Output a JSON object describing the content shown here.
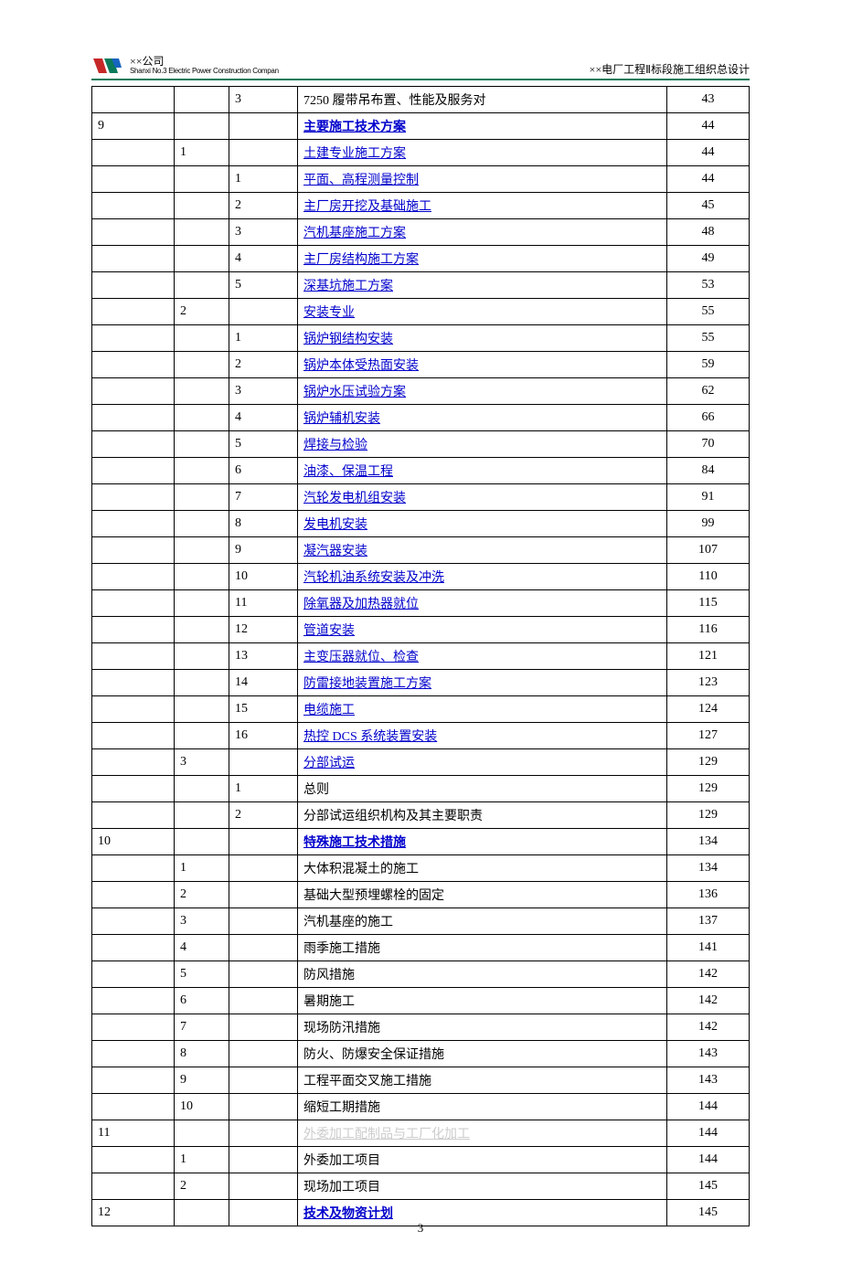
{
  "header": {
    "company_cn": "××公司",
    "company_en": "Shanxi No.3 Electric Power Construction Compan",
    "doc_title": "××电厂工程Ⅱ标段施工组织总设计"
  },
  "page_number": "3",
  "rows": [
    {
      "c1": "",
      "c2": "",
      "c3": "3",
      "title": "7250 履带吊布置、性能及服务对",
      "page": "43",
      "style": "plain"
    },
    {
      "c1": "9",
      "c2": "",
      "c3": "",
      "title": "主要施工技术方案",
      "page": "44",
      "style": "linkbold"
    },
    {
      "c1": "",
      "c2": "1",
      "c3": "",
      "title": "土建专业施工方案",
      "page": "44",
      "style": "link"
    },
    {
      "c1": "",
      "c2": "",
      "c3": "1",
      "title": "平面、高程测量控制",
      "page": "44",
      "style": "link"
    },
    {
      "c1": "",
      "c2": "",
      "c3": "2",
      "title": "主厂房开挖及基础施工",
      "page": "45",
      "style": "link"
    },
    {
      "c1": "",
      "c2": "",
      "c3": "3",
      "title": "汽机基座施工方案",
      "page": "48",
      "style": "link"
    },
    {
      "c1": "",
      "c2": "",
      "c3": "4",
      "title": "主厂房结构施工方案",
      "page": "49",
      "style": "link"
    },
    {
      "c1": "",
      "c2": "",
      "c3": "5",
      "title": "深基坑施工方案",
      "page": "53",
      "style": "link"
    },
    {
      "c1": "",
      "c2": "2",
      "c3": "",
      "title": "安装专业",
      "page": "55",
      "style": "link"
    },
    {
      "c1": "",
      "c2": "",
      "c3": "1",
      "title": "锅炉钢结构安装",
      "page": "55",
      "style": "link"
    },
    {
      "c1": "",
      "c2": "",
      "c3": "2",
      "title": "锅炉本体受热面安装",
      "page": "59",
      "style": "link"
    },
    {
      "c1": "",
      "c2": "",
      "c3": "3",
      "title": "锅炉水压试验方案",
      "page": "62",
      "style": "link"
    },
    {
      "c1": "",
      "c2": "",
      "c3": "4",
      "title": "锅炉辅机安装",
      "page": "66",
      "style": "link"
    },
    {
      "c1": "",
      "c2": "",
      "c3": "5",
      "title": "焊接与检验",
      "page": "70",
      "style": "link"
    },
    {
      "c1": "",
      "c2": "",
      "c3": "6",
      "title": "油漆、保温工程",
      "page": "84",
      "style": "link"
    },
    {
      "c1": "",
      "c2": "",
      "c3": "7",
      "title": "汽轮发电机组安装",
      "page": "91",
      "style": "link"
    },
    {
      "c1": "",
      "c2": "",
      "c3": "8",
      "title": "发电机安装",
      "page": "99",
      "style": "link"
    },
    {
      "c1": "",
      "c2": "",
      "c3": "9",
      "title": "凝汽器安装 ",
      "page": "107",
      "style": "link"
    },
    {
      "c1": "",
      "c2": "",
      "c3": "10",
      "title": "汽轮机油系统安装及冲洗",
      "page": "110",
      "style": "link"
    },
    {
      "c1": "",
      "c2": "",
      "c3": "11",
      "title": "除氧器及加热器就位",
      "page": "115",
      "style": "link"
    },
    {
      "c1": "",
      "c2": "",
      "c3": "12",
      "title": "管道安装",
      "page": "116",
      "style": "link"
    },
    {
      "c1": "",
      "c2": "",
      "c3": "13",
      "title": "主变压器就位、检查",
      "page": "121",
      "style": "link"
    },
    {
      "c1": "",
      "c2": "",
      "c3": "14",
      "title": "防雷接地装置施工方案",
      "page": "123",
      "style": "link"
    },
    {
      "c1": "",
      "c2": "",
      "c3": "15",
      "title": "电缆施工",
      "page": "124",
      "style": "link"
    },
    {
      "c1": "",
      "c2": "",
      "c3": "16",
      "title": "热控 DCS 系统装置安装",
      "page": "127",
      "style": "link"
    },
    {
      "c1": "",
      "c2": "3",
      "c3": "",
      "title": "分部试运",
      "page": "129",
      "style": "link"
    },
    {
      "c1": "",
      "c2": "",
      "c3": "1",
      "title": "总则",
      "page": "129",
      "style": "plain"
    },
    {
      "c1": "",
      "c2": "",
      "c3": "2",
      "title": "分部试运组织机构及其主要职责",
      "page": "129",
      "style": "plain"
    },
    {
      "c1": "10",
      "c2": "",
      "c3": "",
      "title": "特殊施工技术措施",
      "page": "134",
      "style": "linkbold"
    },
    {
      "c1": "",
      "c2": "1",
      "c3": "",
      "title": "大体积混凝土的施工",
      "page": "134",
      "style": "plain"
    },
    {
      "c1": "",
      "c2": "2",
      "c3": "",
      "title": "基础大型预埋螺栓的固定",
      "page": "136",
      "style": "plain"
    },
    {
      "c1": "",
      "c2": "3",
      "c3": "",
      "title": "汽机基座的施工",
      "page": "137",
      "style": "plain"
    },
    {
      "c1": "",
      "c2": "4",
      "c3": "",
      "title": "雨季施工措施",
      "page": "141",
      "style": "plain"
    },
    {
      "c1": "",
      "c2": "5",
      "c3": "",
      "title": "防风措施",
      "page": "142",
      "style": "plain"
    },
    {
      "c1": "",
      "c2": "6",
      "c3": "",
      "title": "暑期施工",
      "page": "142",
      "style": "plain"
    },
    {
      "c1": "",
      "c2": "7",
      "c3": "",
      "title": "现场防汛措施",
      "page": "142",
      "style": "plain"
    },
    {
      "c1": "",
      "c2": "8",
      "c3": "",
      "title": "防火、防爆安全保证措施",
      "page": "143",
      "style": "plain"
    },
    {
      "c1": "",
      "c2": "9",
      "c3": "",
      "title": "工程平面交叉施工措施",
      "page": "143",
      "style": "plain"
    },
    {
      "c1": "",
      "c2": "10",
      "c3": "",
      "title": "缩短工期措施",
      "page": "144",
      "style": "plain"
    },
    {
      "c1": "11",
      "c2": "",
      "c3": "",
      "title": "外委加工配制品与工厂化加工",
      "page": "144",
      "style": "faded"
    },
    {
      "c1": "",
      "c2": "1",
      "c3": "",
      "title": "外委加工项目",
      "page": "144",
      "style": "plain"
    },
    {
      "c1": "",
      "c2": "2",
      "c3": "",
      "title": "现场加工项目",
      "page": "145",
      "style": "plain"
    },
    {
      "c1": "12",
      "c2": "",
      "c3": "",
      "title": "技术及物资计划",
      "page": "145",
      "style": "linkbold"
    }
  ]
}
